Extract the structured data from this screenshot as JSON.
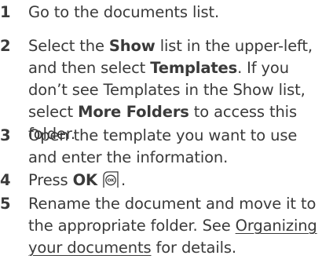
{
  "steps": [
    {
      "number": "1",
      "text": "Go to the documents list."
    },
    {
      "number": "2",
      "pre": "Select the ",
      "bold1": "Show",
      "mid1": " list in the upper-left, and then select ",
      "bold2": "Templates",
      "mid2": ". If you don’t see Templates in the Show list, select ",
      "bold3": "More Folders",
      "post": " to access this folder."
    },
    {
      "number": "3",
      "text": "Open the template you want to use and enter the information."
    },
    {
      "number": "4",
      "pre": "Press ",
      "bold": "OK",
      "post": ".",
      "key_icon": "ok-key-icon"
    },
    {
      "number": "5",
      "pre": "Rename the document and move it to the appropriate folder. See ",
      "link": "Organizing your documents",
      "post": " for details."
    }
  ]
}
